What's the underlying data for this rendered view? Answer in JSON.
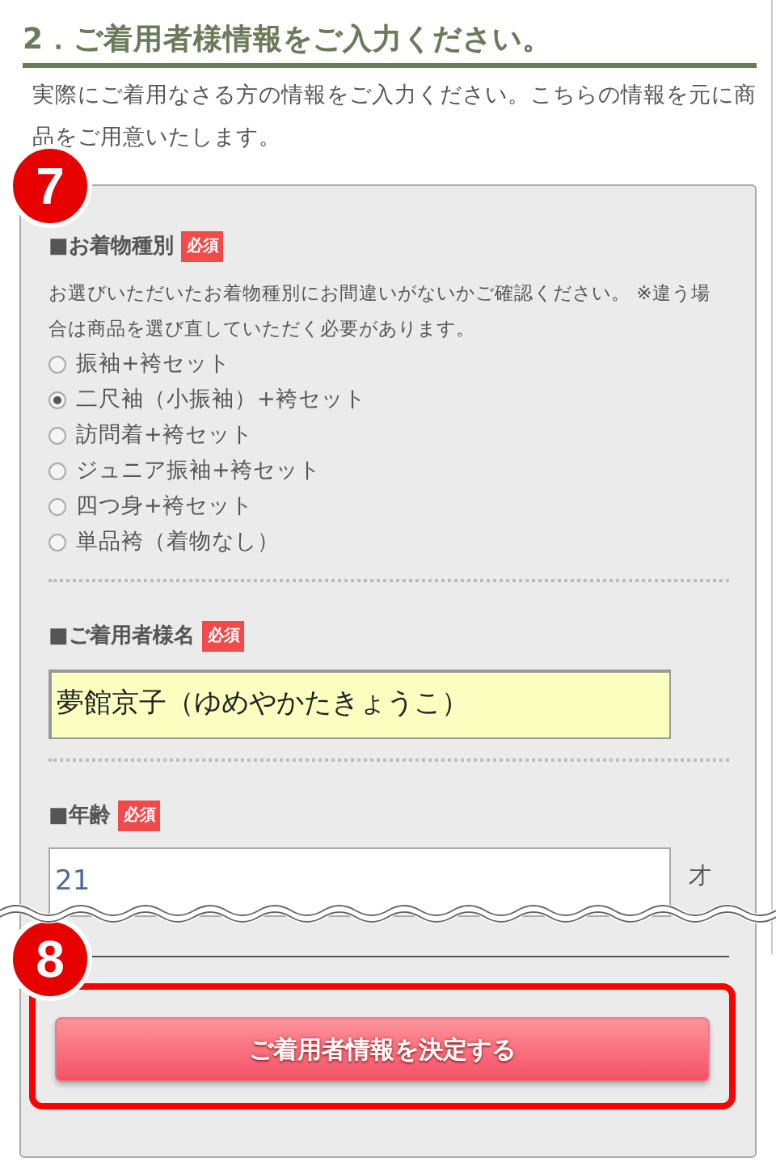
{
  "section": {
    "title": "2．ご着用者様情報をご入力ください。",
    "description": "実際にご着用なさる方の情報をご入力ください。こちらの情報を元に商品をご用意いたします。"
  },
  "form": {
    "step": "7",
    "fields": [
      {
        "kind": "radio",
        "label": "■お着物種別",
        "required_tag": "必須",
        "note": "お選びいただいたお着物種別にお間違いがないかご確認ください。 ※違う場合は商品を選び直していただく必要があります。",
        "options": [
          {
            "label": "振袖+袴セット",
            "selected": false
          },
          {
            "label": "二尺袖（小振袖）+袴セット",
            "selected": true
          },
          {
            "label": "訪問着+袴セット",
            "selected": false
          },
          {
            "label": "ジュニア振袖+袴セット",
            "selected": false
          },
          {
            "label": "四つ身+袴セット",
            "selected": false
          },
          {
            "label": "単品袴（着物なし）",
            "selected": false
          }
        ]
      },
      {
        "kind": "name",
        "label": "■ご着用者様名",
        "required_tag": "必須",
        "value": "夢館京子（ゆめやかたきょうこ）"
      },
      {
        "kind": "age",
        "label": "■年齢",
        "required_tag": "必須",
        "value": "21",
        "unit": "才"
      }
    ]
  },
  "submit": {
    "step": "8",
    "label": "ご着用者情報を決定する"
  }
}
